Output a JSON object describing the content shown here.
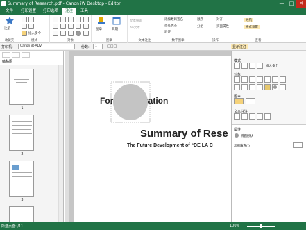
{
  "window": {
    "title": "Summary of Research.pdf - Canon iW Desktop - Editor",
    "minimize": "—",
    "maximize": "□",
    "close": "✕"
  },
  "menu": [
    {
      "label": "文件",
      "active": false
    },
    {
      "label": "打印设置",
      "active": false
    },
    {
      "label": "打印选项",
      "active": false
    },
    {
      "label": "注注",
      "active": true
    },
    {
      "label": "工具",
      "active": false
    }
  ],
  "ribbon": {
    "groups": [
      "收藏夹",
      "模式",
      "对象",
      "图章",
      "文本注注",
      "数字图章",
      "操作",
      "查看"
    ],
    "register_label": "注册",
    "insert_label": "插入多个",
    "arrow_label": "图章",
    "date_label": "日期",
    "text_search_label": "文本搜索",
    "text_search_2": "Ab文本",
    "show_annot": "添加数码签名",
    "confirm": "签名状态",
    "verify": "验证",
    "order_label": "顺序",
    "align_label": "对齐",
    "group_label": "分组",
    "distribute_label": "页面属性",
    "nav_label": "导航",
    "attr_label": "格式设置"
  },
  "optbar": {
    "printer_label": "打印机:",
    "printer_value": "Canon iR-ADV",
    "copies_label": "份数:",
    "copies_value": "1",
    "scale": "□□□",
    "show_annot": "显示注注"
  },
  "left_pane": {
    "title": "缩略图",
    "pages": [
      "1",
      "2",
      "3"
    ]
  },
  "document": {
    "line1": "For:",
    "line1b": "ration",
    "title": "Summary of Rese",
    "subtitle": "The Future Development of “DE LA C"
  },
  "right_pane": {
    "mode_label": "模式",
    "insert_label": "插入多个",
    "object_label": "对象",
    "stamp_label": "图章",
    "text_annot_label": "文本注注",
    "props_label": "属性",
    "shape_name": "椭圆形状",
    "fill_label": "示例填充(I)"
  },
  "status": {
    "pages": "所选页面: /11",
    "zoom": "100%"
  }
}
